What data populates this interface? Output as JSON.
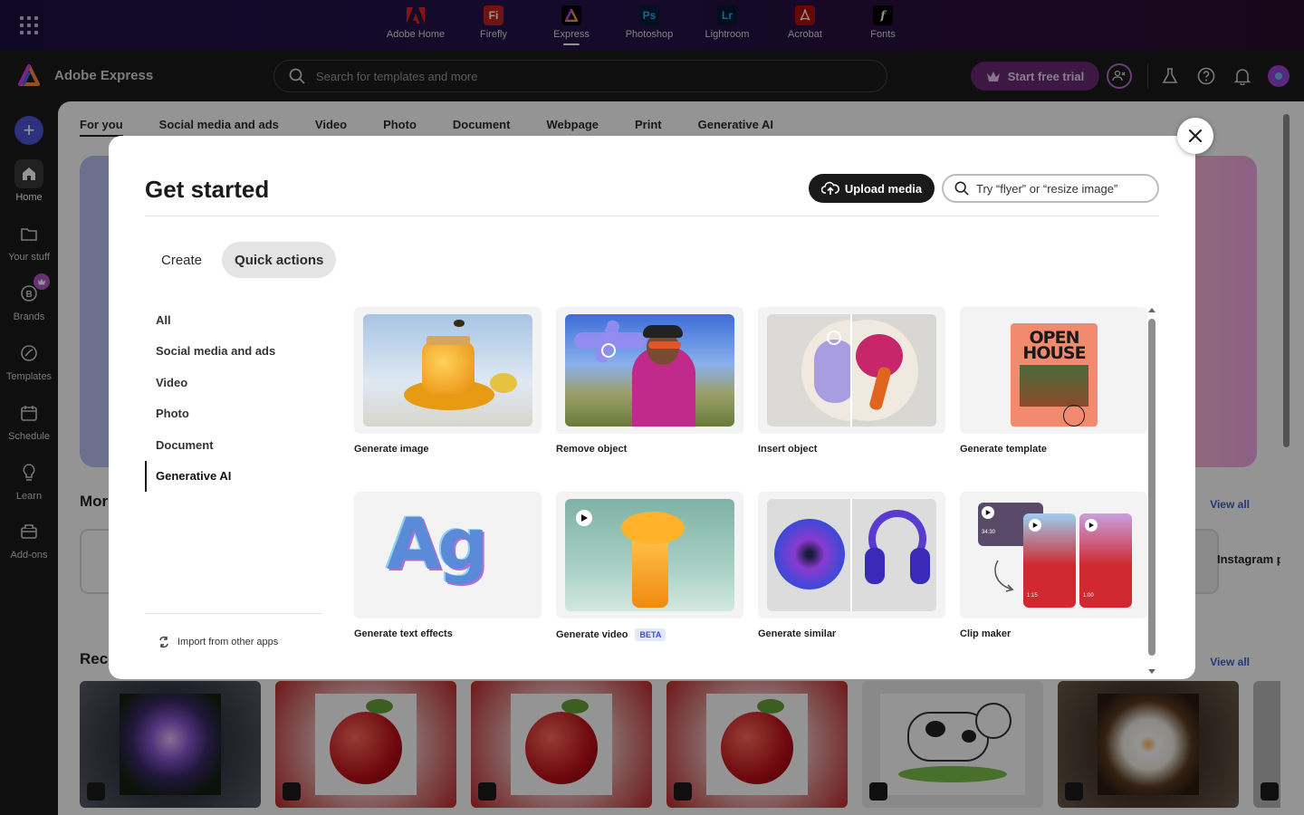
{
  "apps": [
    "Adobe Home",
    "Firefly",
    "Express",
    "Photoshop",
    "Lightroom",
    "Acrobat",
    "Fonts"
  ],
  "app_icon_letters": {
    "firefly": "Fi",
    "photoshop": "Ps",
    "lightroom": "Lr",
    "fonts": "f"
  },
  "header": {
    "brand": "Adobe Express",
    "search_placeholder": "Search for templates and more",
    "trial_label": "Start free trial"
  },
  "rail": [
    "Home",
    "Your stuff",
    "Brands",
    "Templates",
    "Schedule",
    "Learn",
    "Add-ons"
  ],
  "page": {
    "tabs": [
      "For you",
      "Social media and ads",
      "Video",
      "Photo",
      "Document",
      "Webpage",
      "Print",
      "Generative AI"
    ],
    "more_title": "Mor",
    "recent_title": "Rece",
    "view_all": "View all",
    "instagram": "Instagram p"
  },
  "modal": {
    "title": "Get started",
    "upload_label": "Upload media",
    "search_placeholder": "Try “flyer” or “resize image”",
    "tabs": [
      "Create",
      "Quick actions"
    ],
    "categories": [
      "All",
      "Social media and ads",
      "Video",
      "Photo",
      "Document",
      "Generative AI"
    ],
    "import_label": "Import from other apps",
    "cards": [
      "Generate image",
      "Remove object",
      "Insert object",
      "Generate template",
      "Generate text effects",
      "Generate video",
      "Generate similar",
      "Clip maker"
    ],
    "beta_badge": "BETA",
    "template_poster_text": "OPEN HOUSE",
    "text_effect_sample": "Ag",
    "clip_times": [
      "34:30",
      "1:15",
      "1:00"
    ]
  },
  "colors": {
    "accent": "#4c53d8",
    "trial": "#6a2a72",
    "link": "#3f5fd8"
  }
}
